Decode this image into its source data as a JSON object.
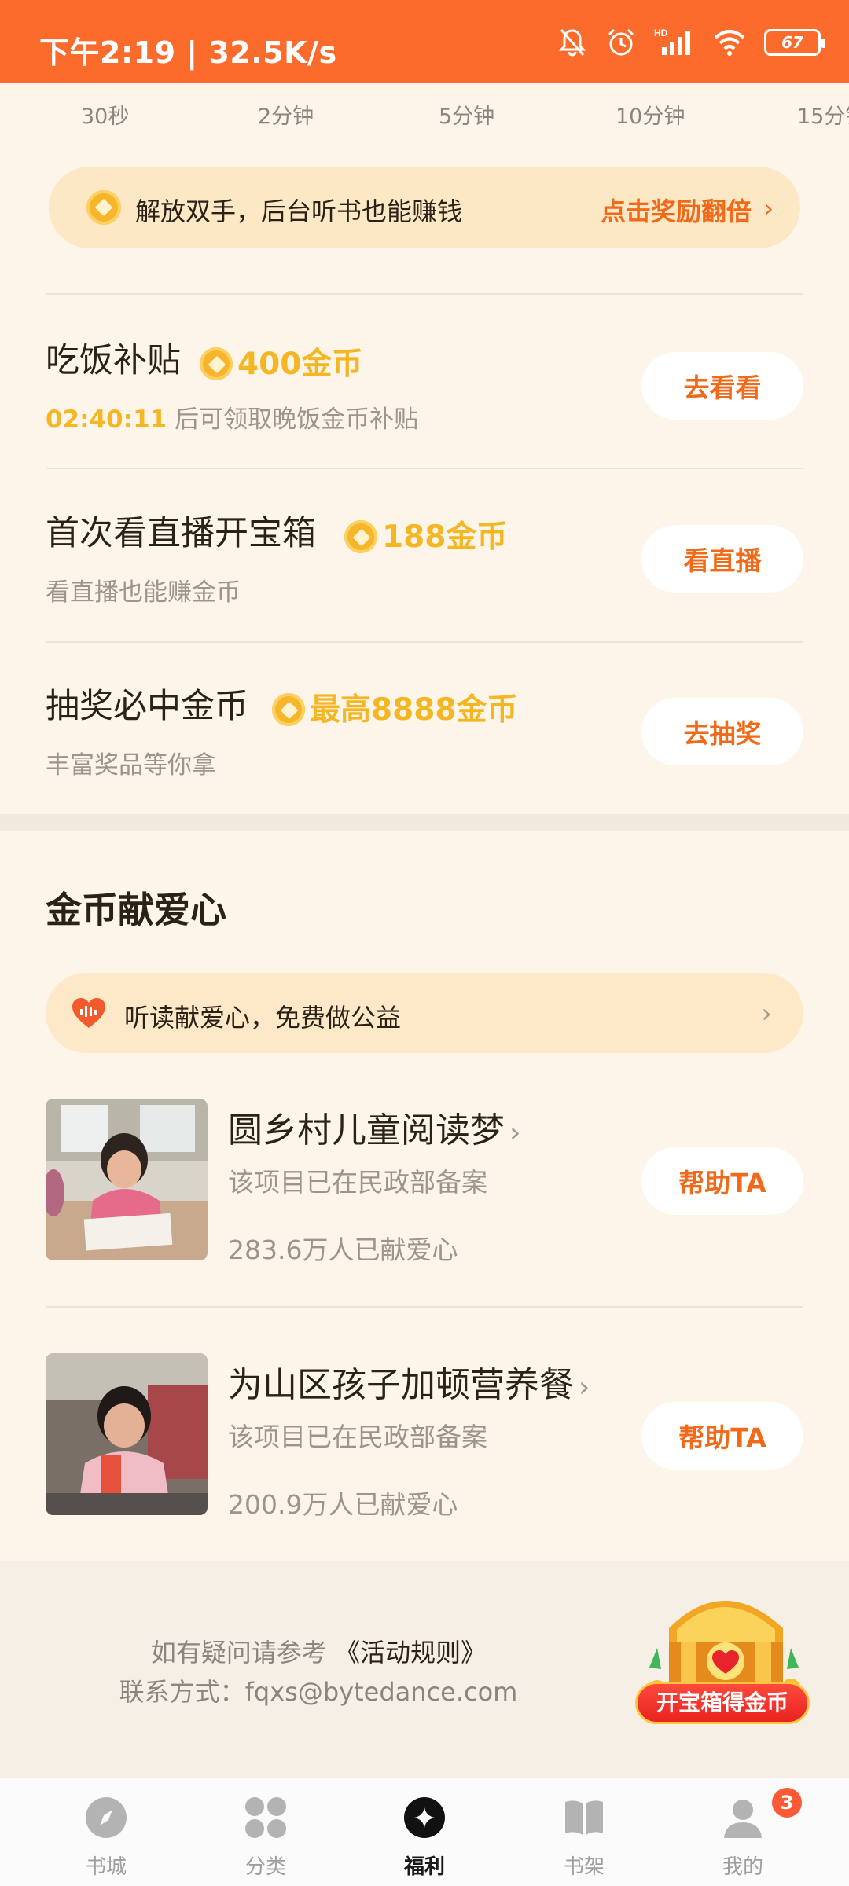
{
  "status_bar": {
    "time_speed": "下午2:19 | 32.5K/s",
    "battery": "67",
    "network_badge": "HD"
  },
  "timeline": [
    "30秒",
    "2分钟",
    "5分钟",
    "10分钟",
    "15分钟"
  ],
  "promo": {
    "text": "解放双手，后台听书也能赚钱",
    "cta": "点击奖励翻倍"
  },
  "tasks": [
    {
      "title": "吃饭补贴",
      "reward": "400金币",
      "countdown": "02:40:11",
      "subtitle": " 后可领取晚饭金币补贴",
      "button": "去看看"
    },
    {
      "title": "首次看直播开宝箱",
      "reward": "188金币",
      "subtitle": "看直播也能赚金币",
      "button": "看直播"
    },
    {
      "title": "抽奖必中金币",
      "reward": "最高8888金币",
      "subtitle": "丰富奖品等你拿",
      "button": "去抽奖"
    }
  ],
  "charity": {
    "title": "金币献爱心",
    "banner_text": "听读献爱心，免费做公益",
    "projects": [
      {
        "title": "圆乡村儿童阅读梦",
        "note": "该项目已在民政部备案",
        "count": "283.6万人已献爱心",
        "button": "帮助TA"
      },
      {
        "title": "为山区孩子加顿营养餐",
        "note": "该项目已在民政部备案",
        "count": "200.9万人已献爱心",
        "button": "帮助TA"
      }
    ]
  },
  "footer": {
    "question_prefix": "如有疑问请参考 ",
    "rules_link": "《活动规则》",
    "contact": "联系方式：fqxs@bytedance.com"
  },
  "treasure_chest": {
    "label": "开宝箱得金币"
  },
  "bottom_nav": {
    "items": [
      {
        "label": "书城",
        "icon": "compass-icon"
      },
      {
        "label": "分类",
        "icon": "category-grid-icon"
      },
      {
        "label": "福利",
        "icon": "welfare-icon"
      },
      {
        "label": "书架",
        "icon": "bookshelf-icon"
      },
      {
        "label": "我的",
        "icon": "profile-icon"
      }
    ],
    "active_index": 2,
    "profile_badge": "3"
  },
  "colors": {
    "brand_orange": "#fb6b2c",
    "accent_orange": "#f06a1a",
    "coin_gold": "#f5b623",
    "background": "#fdf5ea"
  }
}
